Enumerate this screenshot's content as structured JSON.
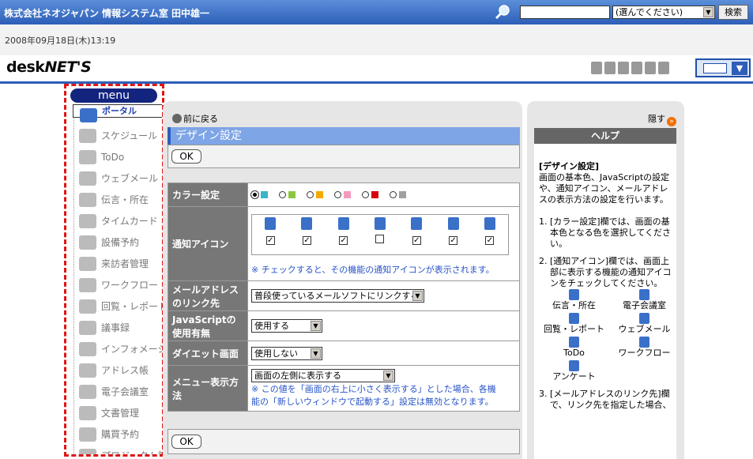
{
  "top": {
    "company": "株式会社ネオジャパン 情報システム室 田中雄一",
    "search_value": "",
    "search_select": "(選んでください)",
    "search_button": "検索"
  },
  "datetime": "2008年09月18日(木)13:19",
  "logo": {
    "part1": "desk",
    "part2": "NET'S"
  },
  "menu": {
    "label": "menu",
    "items": [
      {
        "label": "ポータル",
        "icon": "home-icon",
        "selected": true
      },
      {
        "label": "スケジュール",
        "icon": "calendar-icon"
      },
      {
        "label": "ToDo",
        "icon": "todo-icon"
      },
      {
        "label": "ウェブメール",
        "icon": "mail-icon"
      },
      {
        "label": "伝言・所在",
        "icon": "person-icon"
      },
      {
        "label": "タイムカード",
        "icon": "clock-icon"
      },
      {
        "label": "設備予約",
        "icon": "facility-icon"
      },
      {
        "label": "来訪者管理",
        "icon": "visitor-icon"
      },
      {
        "label": "ワークフロー",
        "icon": "workflow-icon"
      },
      {
        "label": "回覧・レポート",
        "icon": "report-icon"
      },
      {
        "label": "議事録",
        "icon": "minutes-icon"
      },
      {
        "label": "インフォメーション",
        "icon": "info-icon"
      },
      {
        "label": "アドレス帳",
        "icon": "addressbook-icon"
      },
      {
        "label": "電子会議室",
        "icon": "conference-icon"
      },
      {
        "label": "文書管理",
        "icon": "document-icon"
      },
      {
        "label": "購買予約",
        "icon": "purchase-icon"
      },
      {
        "label": "プロジェクト管理",
        "icon": "project-icon"
      }
    ]
  },
  "main": {
    "back": "前に戻る",
    "title": "デザイン設定",
    "ok": "OK",
    "color": {
      "label": "カラー設定",
      "swatches": [
        "#3bb5c8",
        "#8cc63f",
        "#f6a800",
        "#f49ac1",
        "#d7000f",
        "#a0a0a0"
      ],
      "selected": 0
    },
    "notify": {
      "label": "通知アイコン",
      "icons": [
        "person-icon",
        "conference-icon",
        "report-icon",
        "mail-icon",
        "todo-icon",
        "workflow-icon",
        "survey-icon"
      ],
      "checked": [
        true,
        true,
        true,
        false,
        true,
        true,
        true
      ],
      "note": "※ チェックすると、その機能の通知アイコンが表示されます。"
    },
    "mail_link": {
      "label_line1": "メールアドレス",
      "label_line2": "のリンク先",
      "value": "普段使っているメールソフトにリンクする"
    },
    "javascript": {
      "label_line1": "JavaScriptの",
      "label_line2": "使用有無",
      "value": "使用する"
    },
    "diet": {
      "label": "ダイエット画面",
      "value": "使用しない"
    },
    "menu_display": {
      "label_line1": "メニュー表示方",
      "label_line2": "法",
      "value": "画面の左側に表示する",
      "note_line1": "※ この値を「画面の右上に小さく表示する」とした場合、各機",
      "note_line2": "能の「新しいウィンドウで起動する」設定は無効となります。"
    }
  },
  "help": {
    "hide": "隠す",
    "header": "ヘルプ",
    "title": "[デザイン設定]",
    "intro": "画面の基本色、JavaScriptの設定や、通知アイコン、メールアドレスの表示方法の設定を行います。",
    "steps": [
      "[カラー設定]欄では、画面の基本色となる色を選択してください。",
      "[通知アイコン]欄では、画面上部に表示する機能の通知アイコンをチェックしてください。",
      "[メールアドレスのリンク先]欄で、リンク先を指定した場合、"
    ],
    "icon_labels": [
      "伝言・所在",
      "電子会議室",
      "回覧・レポート",
      "ウェブメール",
      "ToDo",
      "ワークフロー",
      "アンケート"
    ]
  }
}
